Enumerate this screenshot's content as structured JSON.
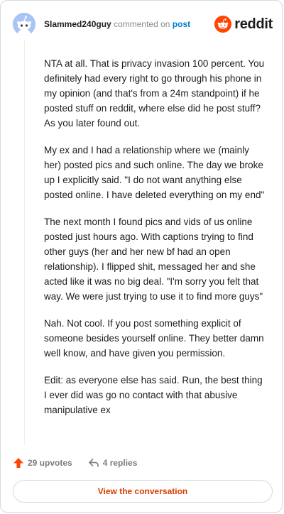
{
  "comment": {
    "username": "Slammed240guy",
    "action_text": "commented on",
    "post_link_label": "post",
    "paragraphs": [
      "NTA at all. That is privacy invasion 100 percent. You definitely had every right to go through his phone in my opinion (and that's from a 24m standpoint) if he posted stuff on reddit, where else did he post stuff? As you later found out.",
      "My ex and I had a relationship where we (mainly her) posted pics and such online. The day we broke up I explicitly said. \"I do not want anything else posted online. I have deleted everything on my end\"",
      "The next month I found pics and vids of us online posted just hours ago. With captions trying to find other guys (her and her new bf had an open relationship). I flipped shit, messaged her and she acted like it was no big deal. \"I'm sorry you felt that way. We were just trying to use it to find more guys\"",
      "Nah. Not cool. If you post something explicit of someone besides yourself online. They better damn well know, and have given you permission.",
      "Edit: as everyone else has said. Run, the best thing I ever did was go no contact with that abusive manipulative ex"
    ],
    "upvotes_label": "29 upvotes",
    "replies_label": "4 replies"
  },
  "brand": {
    "name": "reddit",
    "accent": "#ff4500"
  },
  "view_button_label": "View the conversation",
  "colors": {
    "upvote": "#ff4500",
    "link": "#0079d3",
    "cta": "#d93a00"
  }
}
